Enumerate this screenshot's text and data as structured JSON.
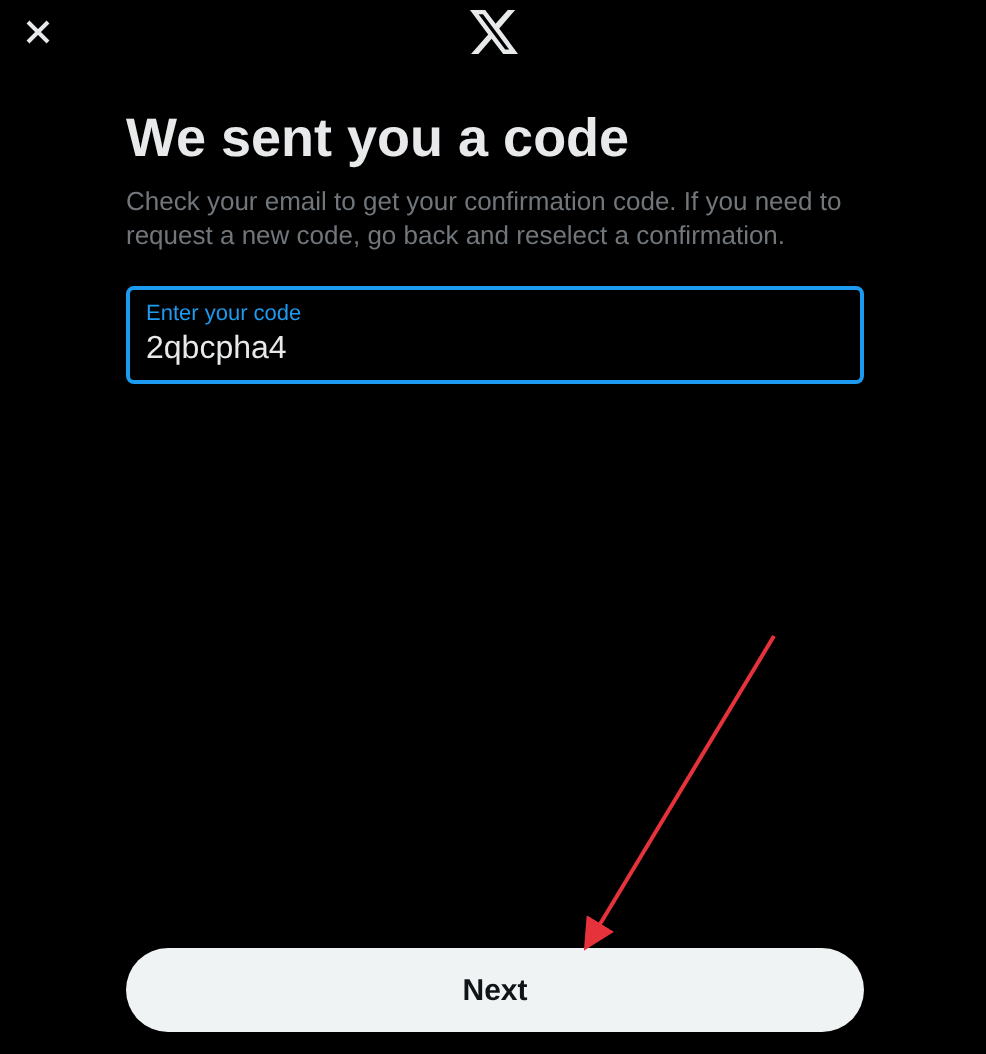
{
  "title": "We sent you a code",
  "description": "Check your email to get your confirmation code. If you need to request a new code, go back and reselect a confirmation.",
  "code_field": {
    "label": "Enter your code",
    "value": "2qbcpha4",
    "focused": true
  },
  "next_button": {
    "label": "Next"
  }
}
